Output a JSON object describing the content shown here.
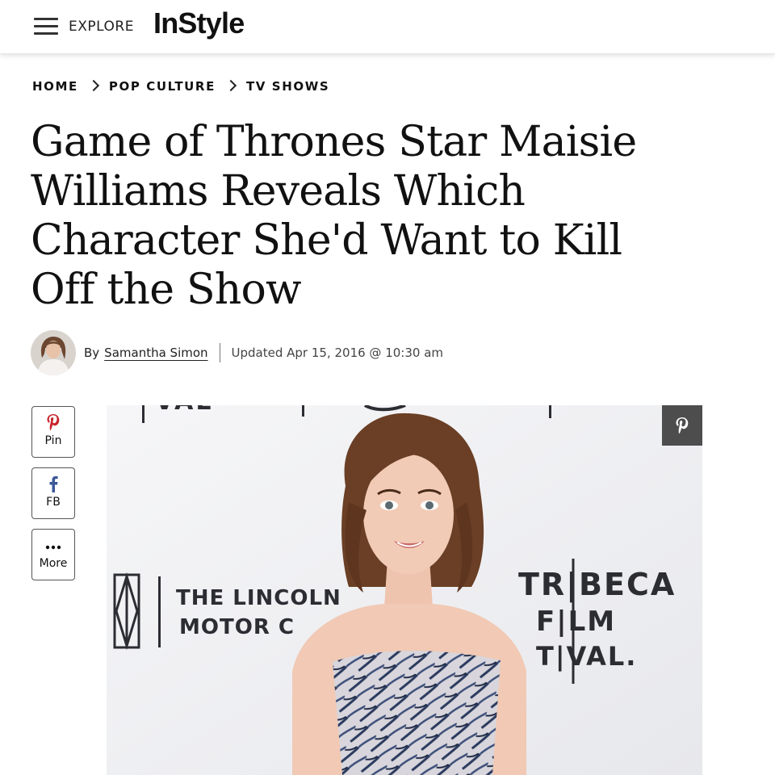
{
  "header": {
    "explore_label": "EXPLORE",
    "logo_text": "InStyle"
  },
  "breadcrumb": {
    "items": [
      "HOME",
      "POP CULTURE",
      "TV SHOWS"
    ]
  },
  "article": {
    "headline": "Game of Thrones Star Maisie Williams Reveals Which Character She'd Want to Kill Off the Show",
    "by_label": "By",
    "author": "Samantha Simon",
    "updated": "Updated Apr 15, 2016 @ 10:30 am"
  },
  "share": {
    "pin_label": "Pin",
    "fb_label": "FB",
    "more_label": "More"
  },
  "hero": {
    "backdrop_lincoln_line1": "THE LINCOLN",
    "backdrop_lincoln_line2": "MOTOR C",
    "backdrop_tribeca_line1": "TR|BECA",
    "backdrop_tribeca_line2": "F|LM",
    "backdrop_tribeca_line3": "T|VAL.",
    "backdrop_top": "VAL"
  },
  "colors": {
    "pinterest_red": "#c8232c",
    "facebook_blue": "#3b5998",
    "pin_overlay": "#4d4d4d"
  },
  "icons": {
    "menu": "hamburger-icon",
    "chevron": "chevron-right-icon",
    "pinterest": "pinterest-icon",
    "facebook": "facebook-icon",
    "more": "ellipsis-icon"
  }
}
